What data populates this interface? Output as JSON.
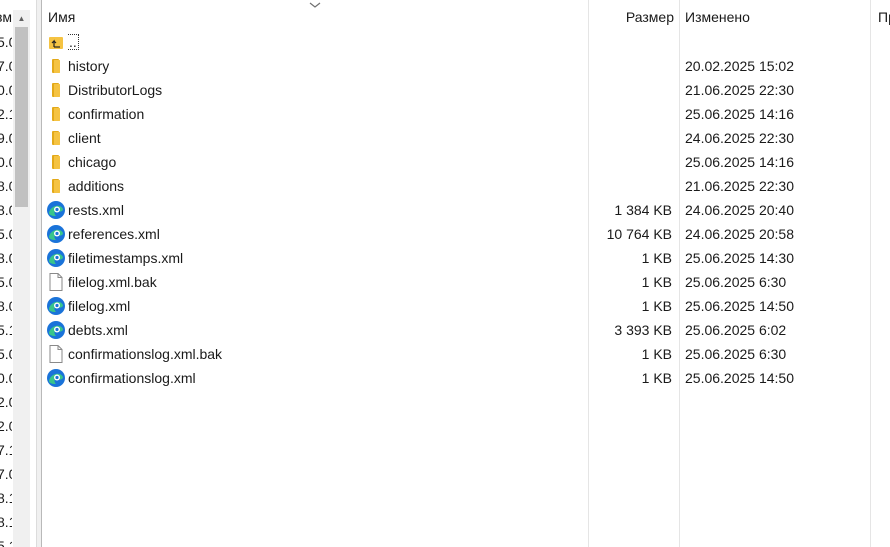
{
  "left_pane": {
    "header_fragment": "зм",
    "numbers": [
      "5.0",
      "7.0",
      "0.0",
      "2.1",
      "9.0",
      "0.0",
      "8.0",
      "8.0",
      "5.0",
      "8.0",
      "5.0",
      "8.0",
      "5.1",
      "5.0",
      "0.0",
      "2.0",
      "2.0",
      "7.1",
      "7.0",
      "8.1",
      "8.1",
      "5.1"
    ]
  },
  "columns": {
    "name": "Имя",
    "size": "Размер",
    "modified": "Изменено",
    "extra": "Пр"
  },
  "files": [
    {
      "name": "..",
      "type": "parent",
      "size": "",
      "modified": ""
    },
    {
      "name": "history",
      "type": "folder",
      "size": "",
      "modified": "20.02.2025 15:02"
    },
    {
      "name": "DistributorLogs",
      "type": "folder",
      "size": "",
      "modified": "21.06.2025 22:30"
    },
    {
      "name": "confirmation",
      "type": "folder",
      "size": "",
      "modified": "25.06.2025 14:16"
    },
    {
      "name": "client",
      "type": "folder",
      "size": "",
      "modified": "24.06.2025 22:30"
    },
    {
      "name": "chicago",
      "type": "folder",
      "size": "",
      "modified": "25.06.2025 14:16"
    },
    {
      "name": "additions",
      "type": "folder",
      "size": "",
      "modified": "21.06.2025 22:30"
    },
    {
      "name": "rests.xml",
      "type": "xml",
      "size": "1 384 KB",
      "modified": "24.06.2025 20:40"
    },
    {
      "name": "references.xml",
      "type": "xml",
      "size": "10 764 KB",
      "modified": "24.06.2025 20:58"
    },
    {
      "name": "filetimestamps.xml",
      "type": "xml",
      "size": "1 KB",
      "modified": "25.06.2025 14:30"
    },
    {
      "name": "filelog.xml.bak",
      "type": "file",
      "size": "1 KB",
      "modified": "25.06.2025 6:30"
    },
    {
      "name": "filelog.xml",
      "type": "xml",
      "size": "1 KB",
      "modified": "25.06.2025 14:50"
    },
    {
      "name": "debts.xml",
      "type": "xml",
      "size": "3 393 KB",
      "modified": "25.06.2025 6:02"
    },
    {
      "name": "confirmationslog.xml.bak",
      "type": "file",
      "size": "1 KB",
      "modified": "25.06.2025 6:30"
    },
    {
      "name": "confirmationslog.xml",
      "type": "xml",
      "size": "1 KB",
      "modified": "25.06.2025 14:50"
    }
  ],
  "colors": {
    "folder": "#f5c342",
    "folder_dark": "#e3a919",
    "edge_blue": "#1a73d9",
    "edge_green": "#38c58b",
    "divider": "#e5e5e5"
  }
}
